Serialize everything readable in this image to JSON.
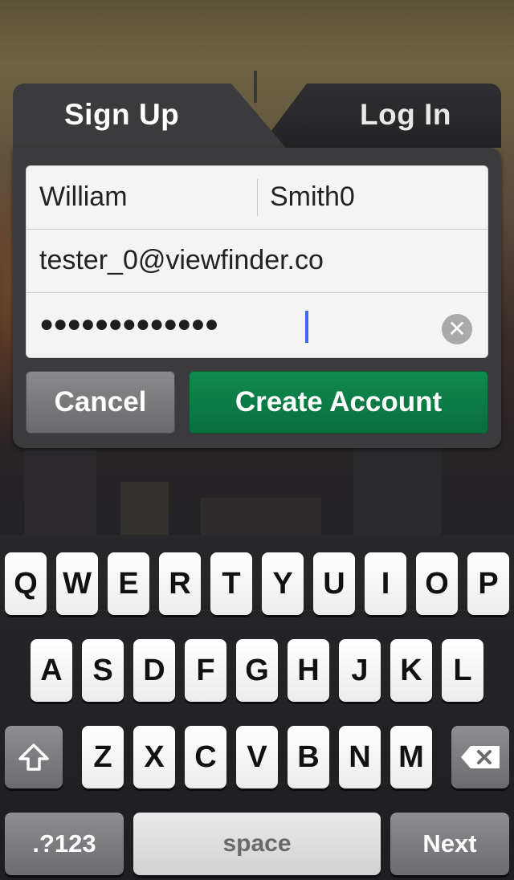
{
  "tabs": {
    "signup": "Sign Up",
    "login": "Log In"
  },
  "form": {
    "first_name": "William",
    "last_name": "Smith0",
    "email": "tester_0@viewfinder.co",
    "password_mask": "●●●●●●●●●●●●●"
  },
  "buttons": {
    "cancel": "Cancel",
    "create": "Create Account"
  },
  "keyboard": {
    "row1": [
      "Q",
      "W",
      "E",
      "R",
      "T",
      "Y",
      "U",
      "I",
      "O",
      "P"
    ],
    "row2": [
      "A",
      "S",
      "D",
      "F",
      "G",
      "H",
      "J",
      "K",
      "L"
    ],
    "row3": [
      "Z",
      "X",
      "C",
      "V",
      "B",
      "N",
      "M"
    ],
    "numbers": ".?123",
    "space": "space",
    "next": "Next"
  },
  "colors": {
    "accent_green": "#0a7a44",
    "cursor_blue": "#3b6cf0"
  }
}
